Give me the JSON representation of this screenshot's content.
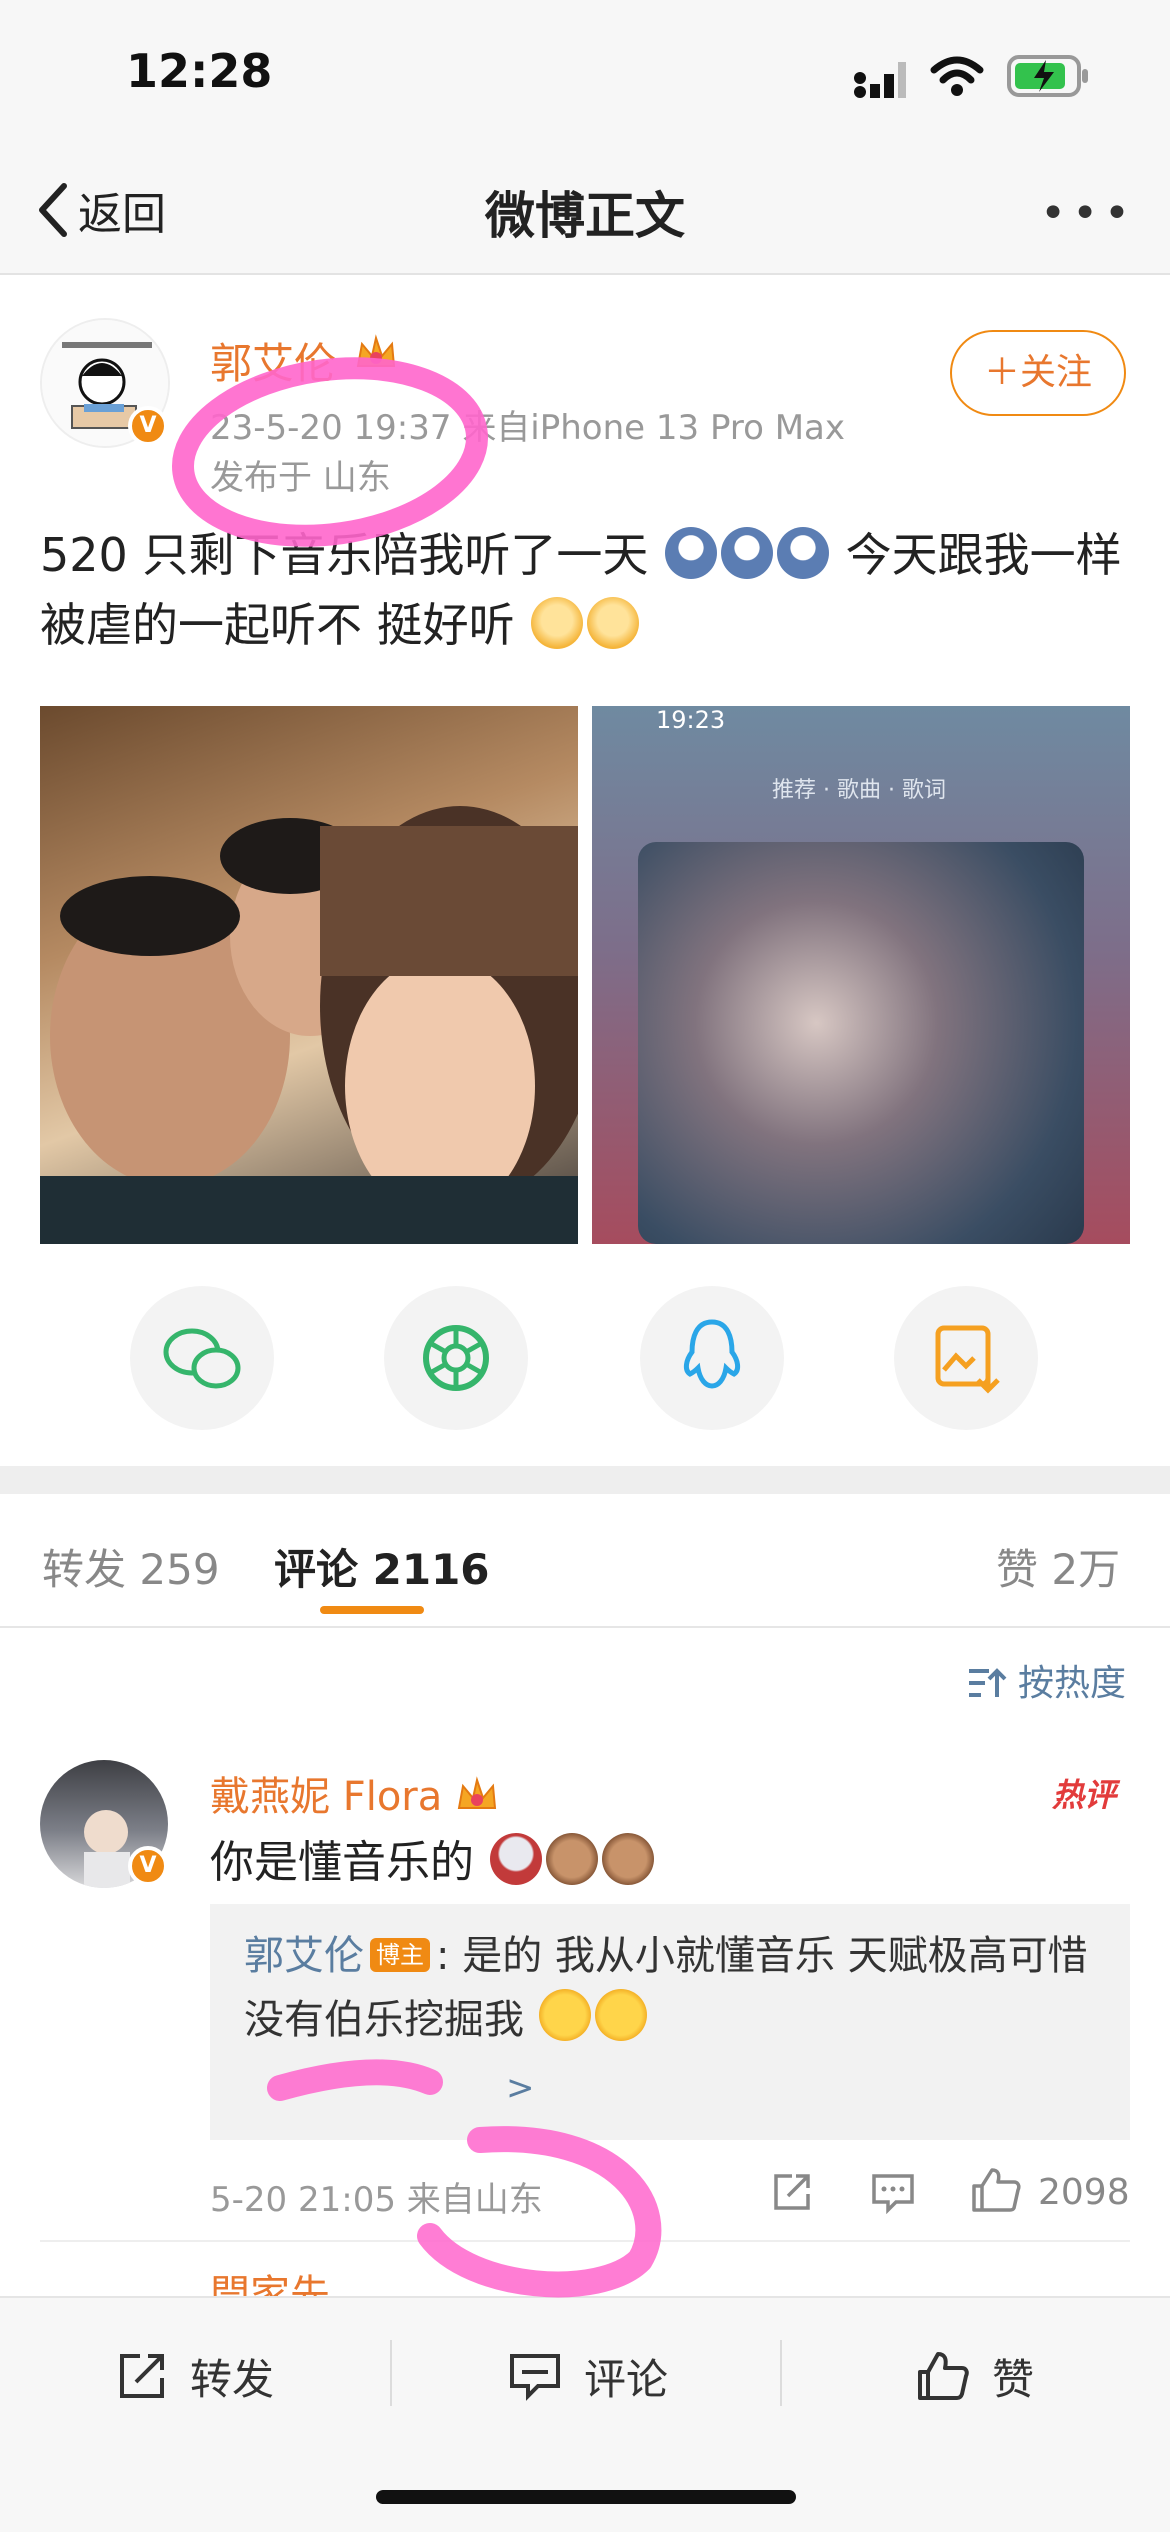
{
  "status_bar": {
    "time": "12:28"
  },
  "nav": {
    "back_label": "返回",
    "title": "微博正文"
  },
  "post": {
    "author": "郭艾伦",
    "meta_time": "23-5-20 19:37",
    "meta_source": "来自iPhone 13 Pro Max",
    "location": "发布于 山东",
    "follow_label": "关注",
    "content_part1": "520 只剩下音乐陪我听了一天",
    "content_part2": "今天跟我一样被虐的一起听不 挺好听",
    "image2_time": "19:23",
    "image2_tabs": "推荐 · 歌曲 · 歌词"
  },
  "tabs": {
    "repost_label": "转发",
    "repost_count": "259",
    "comment_label": "评论",
    "comment_count": "2116",
    "like_label": "赞",
    "like_count": "2万"
  },
  "sort_label": "按热度",
  "comments": [
    {
      "name": "戴燕妮 Flora",
      "badge": "热评",
      "text": "你是懂音乐的",
      "reply_name": "郭艾伦",
      "reply_tag": "博主",
      "reply_text": ": 是的 我从小就懂音乐 天赋极高可惜没有伯乐挖掘我",
      "reply_more": ">",
      "time": "5-20 21:05",
      "source": "来自山东",
      "likes": "2098"
    },
    {
      "name": "閆家先"
    }
  ],
  "bottom_bar": {
    "repost": "转发",
    "comment": "评论",
    "like": "赞"
  },
  "colors": {
    "accent": "#f08a13",
    "link": "#5a7da0",
    "highlight": "#ff66cc"
  }
}
